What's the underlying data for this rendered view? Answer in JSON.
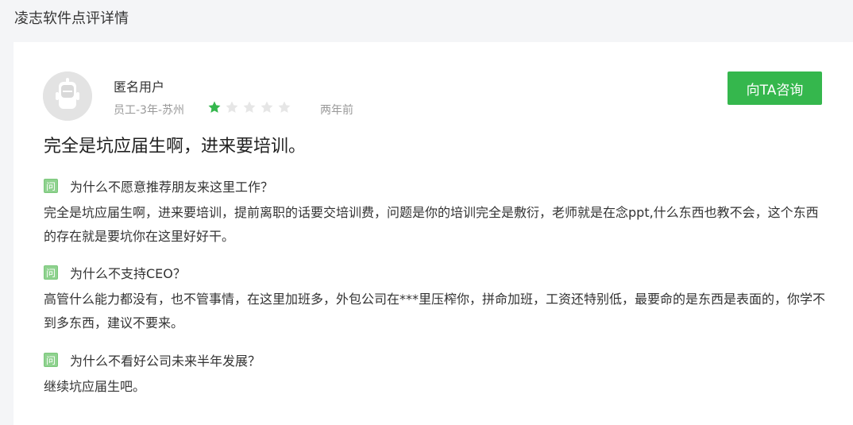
{
  "page": {
    "title": "凌志软件点评详情"
  },
  "review": {
    "user": "匿名用户",
    "meta": "员工-3年-苏州",
    "rating": 1,
    "max_rating": 5,
    "time": "两年前",
    "consult_label": "向TA咨询",
    "headline": "完全是坑应届生啊，进来要培训。",
    "qa": [
      {
        "icon": "问",
        "question": "为什么不愿意推荐朋友来这里工作？",
        "answer": "完全是坑应届生啊，进来要培训，提前离职的话要交培训费，问题是你的培训完全是敷衍，老师就是在念ppt,什么东西也教不会，这个东西的存在就是要坑你在这里好好干。"
      },
      {
        "icon": "问",
        "question": "为什么不支持CEO？",
        "answer": "高管什么能力都没有，也不管事情，在这里加班多，外包公司在***里压榨你，拼命加班，工资还特别低，最要命的是东西是表面的，你学不到多东西，建议不要来。"
      },
      {
        "icon": "问",
        "question": "为什么不看好公司未来半年发展？",
        "answer": "继续坑应届生吧。"
      }
    ]
  },
  "colors": {
    "accent": "#35b74d",
    "star_on": "#35b74d",
    "star_off": "#e6e6e6",
    "question_icon": "#8fd28f"
  },
  "icons": {
    "avatar": "robot-avatar-icon",
    "star": "star-icon",
    "question": "question-badge-icon"
  }
}
